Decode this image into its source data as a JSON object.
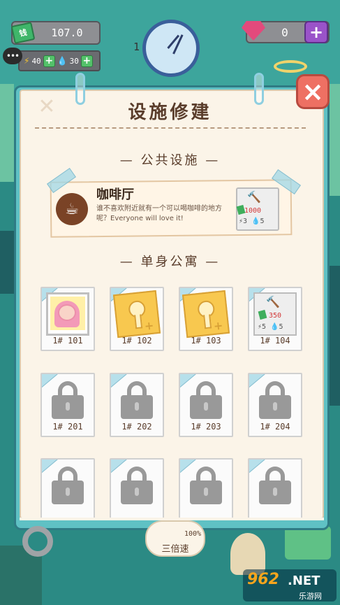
{
  "hud": {
    "money_tag": "钱",
    "money": "107.0",
    "energy": "40",
    "water": "30",
    "gems": "0",
    "clock_digit": "1",
    "chat_icon": "•••"
  },
  "dialog": {
    "title": "设施修建",
    "public_section": "— 公共设施 —",
    "apartment_section": "— 单身公寓 —"
  },
  "cafe": {
    "name": "咖啡厅",
    "description": "谁不喜欢附近就有一个可以喝咖啡的地方呢？Everyone will love it!",
    "cost_money": "1000",
    "cost_energy": "3",
    "cost_water": "5"
  },
  "rooms": [
    {
      "label": "1# 101",
      "state": "occupied"
    },
    {
      "label": "1# 102",
      "state": "key"
    },
    {
      "label": "1# 103",
      "state": "key"
    },
    {
      "label": "1# 104",
      "state": "cost",
      "cost_money": "350",
      "cost_energy": "5",
      "cost_water": "5"
    },
    {
      "label": "1# 201",
      "state": "locked"
    },
    {
      "label": "1# 202",
      "state": "locked"
    },
    {
      "label": "1# 203",
      "state": "locked"
    },
    {
      "label": "1# 204",
      "state": "locked"
    },
    {
      "label": "",
      "state": "locked"
    },
    {
      "label": "",
      "state": "locked"
    },
    {
      "label": "",
      "state": "locked"
    },
    {
      "label": "",
      "state": "locked"
    }
  ],
  "bottom": {
    "speed_label": "三倍速",
    "speed_pct": "100%"
  },
  "watermark": {
    "number": "962",
    "net": ".NET",
    "cn": "乐游网"
  },
  "colors": {
    "panel": "#fbf4e8",
    "frame": "#5fc1c4",
    "close": "#ee7063",
    "text_brown": "#5a3d2b"
  }
}
